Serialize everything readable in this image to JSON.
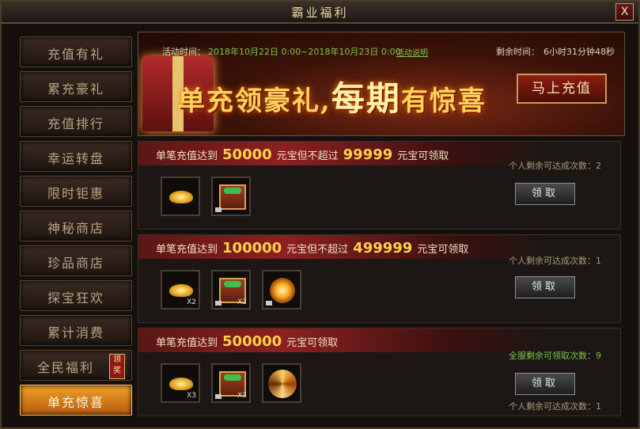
{
  "window": {
    "title": "霸业福利",
    "close_label": "X"
  },
  "sidebar": {
    "items": [
      {
        "label": "充值有礼"
      },
      {
        "label": "累充豪礼"
      },
      {
        "label": "充值排行"
      },
      {
        "label": "幸运转盘"
      },
      {
        "label": "限时钜惠"
      },
      {
        "label": "神秘商店"
      },
      {
        "label": "珍品商店"
      },
      {
        "label": "探宝狂欢"
      },
      {
        "label": "累计消费"
      },
      {
        "label": "全民福利",
        "badge": "领奖"
      },
      {
        "label": "单充惊喜",
        "active": true
      }
    ]
  },
  "banner": {
    "activity_label": "活动时间：",
    "activity_time": "2018年10月22日  0:00~2018年10月23日  0:00",
    "activity_link": "活动说明",
    "remaining_label": "剩余时间：",
    "remaining_value": "6小时31分钟48秒",
    "slogan_left": "单充领豪礼,",
    "slogan_big": "每期",
    "slogan_right": "有惊喜",
    "topup_button": "马上充值"
  },
  "tiers": [
    {
      "cond_prefix": "单笔充值达到",
      "min": "50000",
      "cond_mid": "元宝但不超过",
      "max": "99999",
      "cond_suffix": "元宝可领取",
      "counter": "个人剩余可达成次数：2",
      "items": [
        {
          "icon": "gold-ingot-icon",
          "qty": ""
        },
        {
          "icon": "treasure-chest-icon",
          "qty": ""
        }
      ],
      "claim_label": "领取"
    },
    {
      "cond_prefix": "单笔充值达到",
      "min": "100000",
      "cond_mid": "元宝但不超过",
      "max": "499999",
      "cond_suffix": "元宝可领取",
      "counter": "个人剩余可达成次数：1",
      "items": [
        {
          "icon": "gold-ingot-icon",
          "qty": "X2"
        },
        {
          "icon": "treasure-chest-icon",
          "qty": "X2"
        },
        {
          "icon": "golden-orb-icon",
          "qty": ""
        }
      ],
      "claim_label": "领取"
    },
    {
      "cond_prefix": "单笔充值达到",
      "min": "500000",
      "cond_mid": "",
      "max": "",
      "cond_suffix": "元宝可领取",
      "counter_server": "全服剩余可领取次数：9",
      "counter": "个人剩余可达成次数：1",
      "items": [
        {
          "icon": "gold-ingot-icon",
          "qty": "X3"
        },
        {
          "icon": "treasure-chest-icon",
          "qty": "X3"
        },
        {
          "icon": "swirl-orb-icon",
          "qty": ""
        }
      ],
      "claim_label": "领取"
    }
  ]
}
